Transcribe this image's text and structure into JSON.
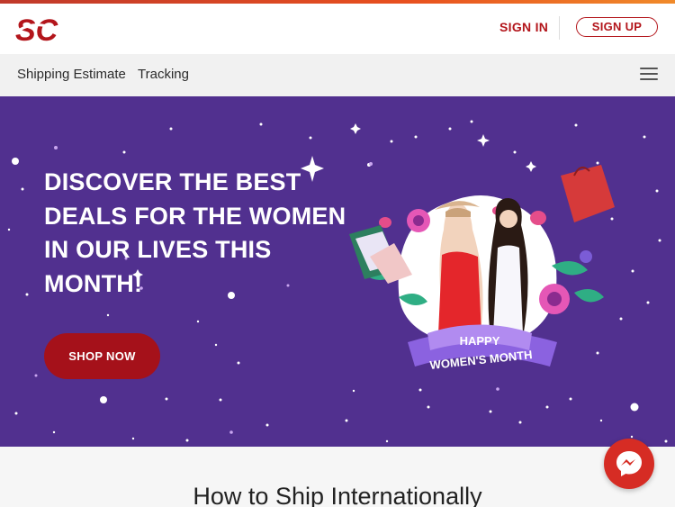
{
  "brand": {
    "logo_text": "SC",
    "accent": "#b3151b",
    "hero_bg": "#51308f"
  },
  "header": {
    "signin_label": "SIGN IN",
    "signup_label": "SIGN UP"
  },
  "nav": {
    "items": [
      {
        "label": "Shipping Estimate"
      },
      {
        "label": "Tracking"
      }
    ],
    "menu_icon": "hamburger-icon"
  },
  "hero": {
    "headline_lines": [
      "DISCOVER THE BEST",
      "DEALS FOR THE WOMEN",
      "IN OUR LIVES THIS",
      "MONTH!"
    ],
    "cta_label": "SHOP NOW",
    "badge_line1": "HAPPY",
    "badge_line2": "WOMEN'S MONTH"
  },
  "section": {
    "title": "How to Ship Internationally"
  },
  "chat": {
    "icon": "messenger-icon"
  }
}
